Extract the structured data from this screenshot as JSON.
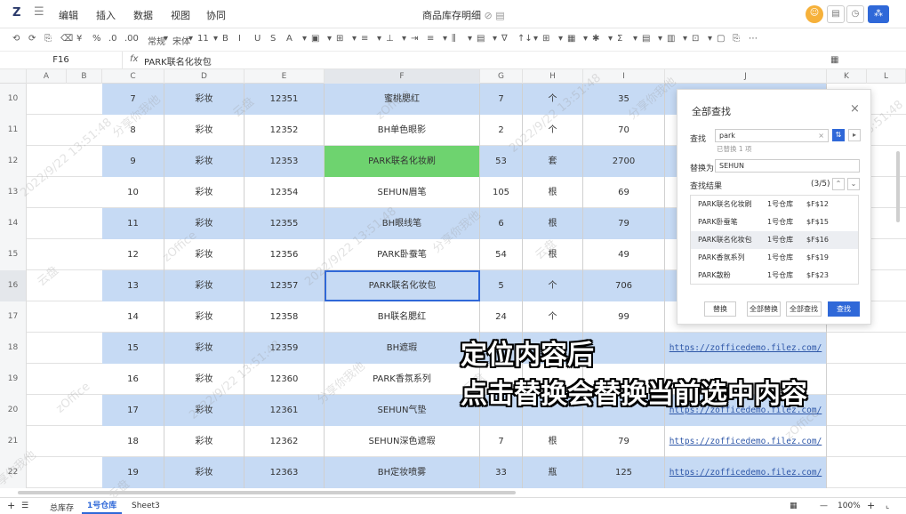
{
  "app": {
    "logo": "Z",
    "title": "商品库存明细",
    "title_icons": "⊘ ▤",
    "menu": [
      "编辑",
      "插入",
      "数据",
      "视图",
      "协同"
    ],
    "avatar": "☺",
    "share": "⁂"
  },
  "toolbar": {
    "items": [
      "⟲",
      "⟳",
      "⎘",
      "⌫",
      "¥",
      "%",
      ".0",
      ".00",
      "常规",
      "▾",
      "宋体",
      "▾",
      "11",
      "▾",
      "B",
      "I",
      "U",
      "S",
      "A",
      "▾",
      "▣",
      "▾",
      "⊞",
      "▾",
      "≡",
      "▾",
      "⊥",
      "▾",
      "⇥",
      "≡",
      "▾",
      "⫼",
      "▾",
      "▤",
      "▾",
      "∇",
      "↑↓",
      "▾",
      "⊞",
      "▾",
      "▦",
      "▾",
      "✱",
      "▾",
      "Σ",
      "▾",
      "▤",
      "▾",
      "▥",
      "▾",
      "⊡",
      "▾",
      "▢",
      "⎘",
      "⋯"
    ]
  },
  "formula": {
    "cell": "F16",
    "fx": "fx",
    "value": "PARK联名化妆包"
  },
  "columns": [
    "A",
    "B",
    "C",
    "D",
    "E",
    "F",
    "G",
    "H",
    "I",
    "J",
    "K",
    "L"
  ],
  "rows": [
    {
      "n": "10",
      "c": "7",
      "d": "彩妆",
      "e": "12351",
      "f": "蜜桃腮红",
      "g": "7",
      "h": "个",
      "i": "35",
      "j": ""
    },
    {
      "n": "11",
      "c": "8",
      "d": "彩妆",
      "e": "12352",
      "f": "BH单色眼影",
      "g": "2",
      "h": "个",
      "i": "70",
      "j": ""
    },
    {
      "n": "12",
      "c": "9",
      "d": "彩妆",
      "e": "12353",
      "f": "PARK联名化妆刷",
      "g": "53",
      "h": "套",
      "i": "2700",
      "j": ""
    },
    {
      "n": "13",
      "c": "10",
      "d": "彩妆",
      "e": "12354",
      "f": "SEHUN眉笔",
      "g": "105",
      "h": "根",
      "i": "69",
      "j": ""
    },
    {
      "n": "14",
      "c": "11",
      "d": "彩妆",
      "e": "12355",
      "f": "BH眼线笔",
      "g": "6",
      "h": "根",
      "i": "79",
      "j": ""
    },
    {
      "n": "15",
      "c": "12",
      "d": "彩妆",
      "e": "12356",
      "f": "PARK卧蚕笔",
      "g": "54",
      "h": "根",
      "i": "49",
      "j": ""
    },
    {
      "n": "16",
      "c": "13",
      "d": "彩妆",
      "e": "12357",
      "f": "PARK联名化妆包",
      "g": "5",
      "h": "个",
      "i": "706",
      "j": ""
    },
    {
      "n": "17",
      "c": "14",
      "d": "彩妆",
      "e": "12358",
      "f": "BH联名腮红",
      "g": "24",
      "h": "个",
      "i": "99",
      "j": ""
    },
    {
      "n": "18",
      "c": "15",
      "d": "彩妆",
      "e": "12359",
      "f": "BH遮瑕",
      "g": "",
      "h": "",
      "i": "",
      "j": "https://zofficedemo.filez.com/"
    },
    {
      "n": "19",
      "c": "16",
      "d": "彩妆",
      "e": "12360",
      "f": "PARK香氛系列",
      "g": "",
      "h": "",
      "i": "",
      "j": ""
    },
    {
      "n": "20",
      "c": "17",
      "d": "彩妆",
      "e": "12361",
      "f": "SEHUN气垫",
      "g": "",
      "h": "",
      "i": "",
      "j": "https://zofficedemo.filez.com/"
    },
    {
      "n": "21",
      "c": "18",
      "d": "彩妆",
      "e": "12362",
      "f": "SEHUN深色遮瑕",
      "g": "7",
      "h": "根",
      "i": "79",
      "j": "https://zofficedemo.filez.com/"
    },
    {
      "n": "22",
      "c": "19",
      "d": "彩妆",
      "e": "12363",
      "f": "BH定妆喷雾",
      "g": "33",
      "h": "瓶",
      "i": "125",
      "j": "https://zofficedemo.filez.com/"
    }
  ],
  "find": {
    "title": "全部查找",
    "close": "×",
    "find_label": "查找",
    "find_value": "park",
    "found_note": "已替换 1 项",
    "replace_label": "替换为",
    "replace_value": "SEHUN",
    "results_label": "查找结果",
    "results_count": "(3/5)",
    "results": [
      {
        "name": "PARK联名化妆刷",
        "sheet": "1号仓库",
        "cell": "$F$12"
      },
      {
        "name": "PARK卧蚕笔",
        "sheet": "1号仓库",
        "cell": "$F$15"
      },
      {
        "name": "PARK联名化妆包",
        "sheet": "1号仓库",
        "cell": "$F$16"
      },
      {
        "name": "PARK香氛系列",
        "sheet": "1号仓库",
        "cell": "$F$19"
      },
      {
        "name": "PARK散粉",
        "sheet": "1号仓库",
        "cell": "$F$23"
      }
    ],
    "buttons": [
      "替换",
      "全部替换",
      "全部查找",
      "查找"
    ]
  },
  "caption": {
    "line1": "定位内容后",
    "line2": "点击替换会替换当前选中内容"
  },
  "sheets": [
    "总库存",
    "1号仓库",
    "Sheet3"
  ],
  "status": {
    "zoom": "100%",
    "plus": "+",
    "minus": "—"
  },
  "watermarks": [
    "2022/9/22 13:51:48",
    "分享你我他",
    "云盘",
    "zOffice"
  ],
  "colors": {
    "blue_fill": "#c6daf4",
    "green_fill": "#6ed36f",
    "accent": "#2f68d8",
    "selected_border": "#2f68d8"
  }
}
